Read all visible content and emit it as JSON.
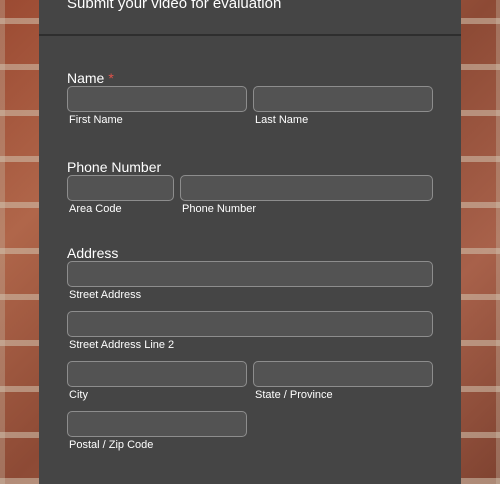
{
  "form": {
    "title": "Submit your video for evaluation",
    "name": {
      "label": "Name",
      "required_mark": "*",
      "first": {
        "value": "",
        "sublabel": "First Name"
      },
      "last": {
        "value": "",
        "sublabel": "Last Name"
      }
    },
    "phone": {
      "label": "Phone Number",
      "area": {
        "value": "",
        "sublabel": "Area Code"
      },
      "number": {
        "value": "",
        "sublabel": "Phone Number"
      }
    },
    "address": {
      "label": "Address",
      "street": {
        "value": "",
        "sublabel": "Street Address"
      },
      "street2": {
        "value": "",
        "sublabel": "Street Address Line 2"
      },
      "city": {
        "value": "",
        "sublabel": "City"
      },
      "state": {
        "value": "",
        "sublabel": "State / Province"
      },
      "zip": {
        "value": "",
        "sublabel": "Postal / Zip Code"
      }
    }
  },
  "colors": {
    "panel": "#454545",
    "input_bg": "#535353",
    "input_border": "#8d8d8d",
    "required": "#e0524a"
  }
}
